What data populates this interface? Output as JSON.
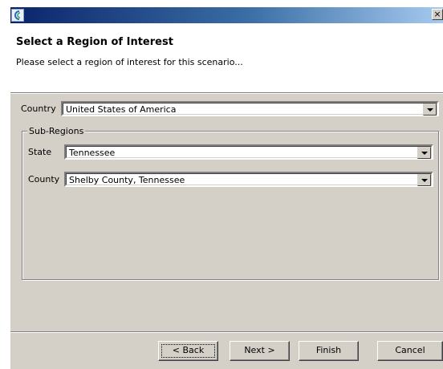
{
  "window": {
    "close_glyph": "×",
    "app_icon": "app-logo-icon"
  },
  "header": {
    "title": "Select a Region of Interest",
    "description": "Please select a region of interest for this scenario..."
  },
  "country": {
    "label": "Country",
    "value": "United States of America"
  },
  "subregions": {
    "group_label": "Sub-Regions",
    "state": {
      "label": "State",
      "value": "Tennessee"
    },
    "county": {
      "label": "County",
      "value": "Shelby County, Tennessee"
    }
  },
  "buttons": {
    "back": "< Back",
    "next": "Next >",
    "finish": "Finish",
    "cancel": "Cancel"
  }
}
